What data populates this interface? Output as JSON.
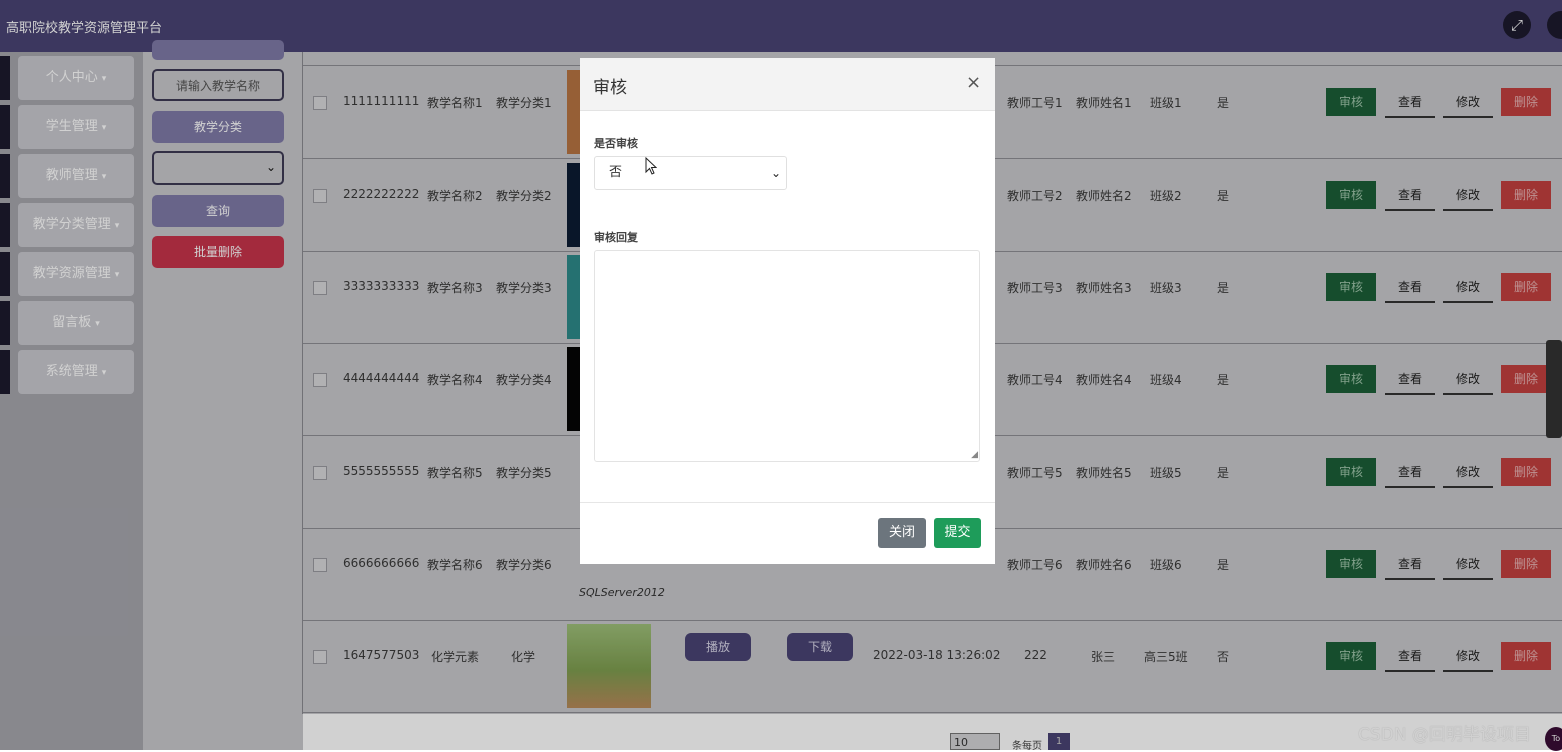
{
  "header": {
    "title": "高职院校教学资源管理平台",
    "fullscreen_icon": "⤢"
  },
  "sidebar": {
    "items": [
      {
        "label": "个人中心"
      },
      {
        "label": "学生管理"
      },
      {
        "label": "教师管理"
      },
      {
        "label": "教学分类管理"
      },
      {
        "label": "教学资源管理"
      },
      {
        "label": "留言板"
      },
      {
        "label": "系统管理"
      }
    ],
    "caret": "▾"
  },
  "search": {
    "name_placeholder": "请输入教学名称",
    "category_button": "教学分类",
    "query_button": "查询",
    "batch_delete_button": "批量删除"
  },
  "table": {
    "rows": [
      {
        "id": "1111111111",
        "name": "教学名称1",
        "category": "教学分类1",
        "play": "",
        "download": "",
        "time": "",
        "teacher_no": "教师工号1",
        "teacher_name": "教师姓名1",
        "class": "班级1",
        "audited": "是",
        "thumb_color": "#b87543"
      },
      {
        "id": "2222222222",
        "name": "教学名称2",
        "category": "教学分类2",
        "play": "",
        "download": "",
        "time": "",
        "teacher_no": "教师工号2",
        "teacher_name": "教师姓名2",
        "class": "班级2",
        "audited": "是",
        "thumb_color": "#0b1b33"
      },
      {
        "id": "3333333333",
        "name": "教学名称3",
        "category": "教学分类3",
        "play": "",
        "download": "",
        "time": "",
        "teacher_no": "教师工号3",
        "teacher_name": "教师姓名3",
        "class": "班级3",
        "audited": "是",
        "thumb_color": "#2e8a8a"
      },
      {
        "id": "4444444444",
        "name": "教学名称4",
        "category": "教学分类4",
        "play": "",
        "download": "",
        "time": "",
        "teacher_no": "教师工号4",
        "teacher_name": "教师姓名4",
        "class": "班级4",
        "audited": "是",
        "thumb_color": "#050505"
      },
      {
        "id": "5555555555",
        "name": "教学名称5",
        "category": "教学分类5",
        "play": "",
        "download": "",
        "time": "",
        "teacher_no": "教师工号5",
        "teacher_name": "教师姓名5",
        "class": "班级5",
        "audited": "是",
        "thumb_color": ""
      },
      {
        "id": "6666666666",
        "name": "教学名称6",
        "category": "教学分类6",
        "play": "",
        "download": "",
        "time": "",
        "teacher_no": "教师工号6",
        "teacher_name": "教师姓名6",
        "class": "班级6",
        "audited": "是",
        "thumb_color": "",
        "thumb_text": "SQLServer2012"
      },
      {
        "id": "1647577503",
        "name": "化学元素",
        "category": "化学",
        "play": "播放",
        "download": "下载",
        "time": "2022-03-18 13:26:02",
        "teacher_no": "222",
        "teacher_name": "张三",
        "class": "高三5班",
        "audited": "否",
        "thumb_color": "#8aa85a"
      }
    ],
    "actions": {
      "audit": "审核",
      "view": "查看",
      "edit": "修改",
      "delete": "删除"
    }
  },
  "pagination": {
    "page_size": "10",
    "per_page_label": "条每页",
    "current_page": "1"
  },
  "modal": {
    "title": "审核",
    "close_icon": "×",
    "audit_label": "是否审核",
    "audit_value": "否",
    "reply_label": "审核回复",
    "reply_value": "",
    "close_button": "关闭",
    "submit_button": "提交"
  },
  "watermark": "CSDN @回明毕设项目",
  "corner_badge": "To",
  "colors": {
    "header_bg": "#4a4474",
    "audit_green": "#1b5e38",
    "delete_red": "#c3403f",
    "submit_green": "#1e9c5a",
    "close_gray": "#6c757d"
  }
}
